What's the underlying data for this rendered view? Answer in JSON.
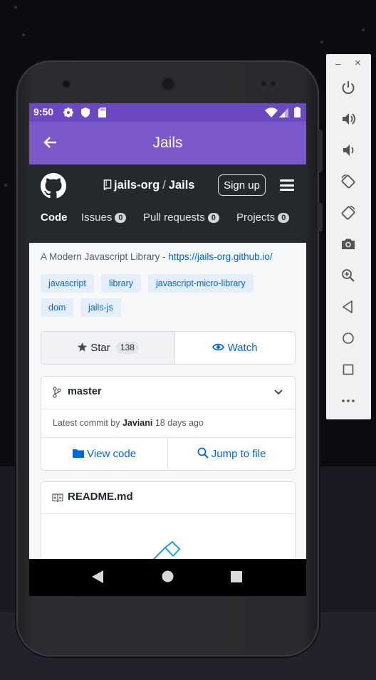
{
  "status_bar": {
    "time": "9:50",
    "left_icons": [
      "gear-icon",
      "shield-icon",
      "sd-card-icon"
    ],
    "right_icons": [
      "wifi-icon",
      "signal-icon",
      "battery-icon"
    ]
  },
  "app_bar": {
    "title": "Jails",
    "back_icon": "arrow-back-icon"
  },
  "github_header": {
    "owner": "jails-org",
    "separator": "/",
    "repo": "Jails",
    "signup_label": "Sign up",
    "tabs": [
      {
        "label": "Code",
        "active": true
      },
      {
        "label": "Issues",
        "count": "0"
      },
      {
        "label": "Pull requests",
        "count": "0"
      },
      {
        "label": "Projects",
        "count": "0"
      }
    ]
  },
  "repo": {
    "description": "A Modern Javascript Library - ",
    "homepage": "https://jails-org.github.io/",
    "topics": [
      "javascript",
      "library",
      "javascript-micro-library",
      "dom",
      "jails-js"
    ],
    "star_label": "Star",
    "star_count": "138",
    "watch_label": "Watch",
    "branch": "master",
    "commit_prefix": "Latest commit by ",
    "commit_author": "Javiani",
    "commit_time": " 18 days ago",
    "view_code_label": "View code",
    "jump_to_file_label": "Jump to file",
    "readme_title": "README.md"
  },
  "nav_bar": {
    "icons": [
      "back-triangle-icon",
      "home-circle-icon",
      "recents-square-icon"
    ]
  },
  "emulator_panel": {
    "minimize": "–",
    "close": "×",
    "icons": [
      "power-icon",
      "volume-up-icon",
      "volume-down-icon",
      "rotate-left-icon",
      "rotate-right-icon",
      "camera-icon",
      "zoom-icon",
      "back-icon",
      "home-icon",
      "overview-icon",
      "more-icon"
    ]
  },
  "colors": {
    "status_bar": "#6c48c2",
    "app_bar": "#7c59cb",
    "github_header": "#24292e",
    "link": "#0366d6",
    "topic_bg": "#e4effb"
  }
}
